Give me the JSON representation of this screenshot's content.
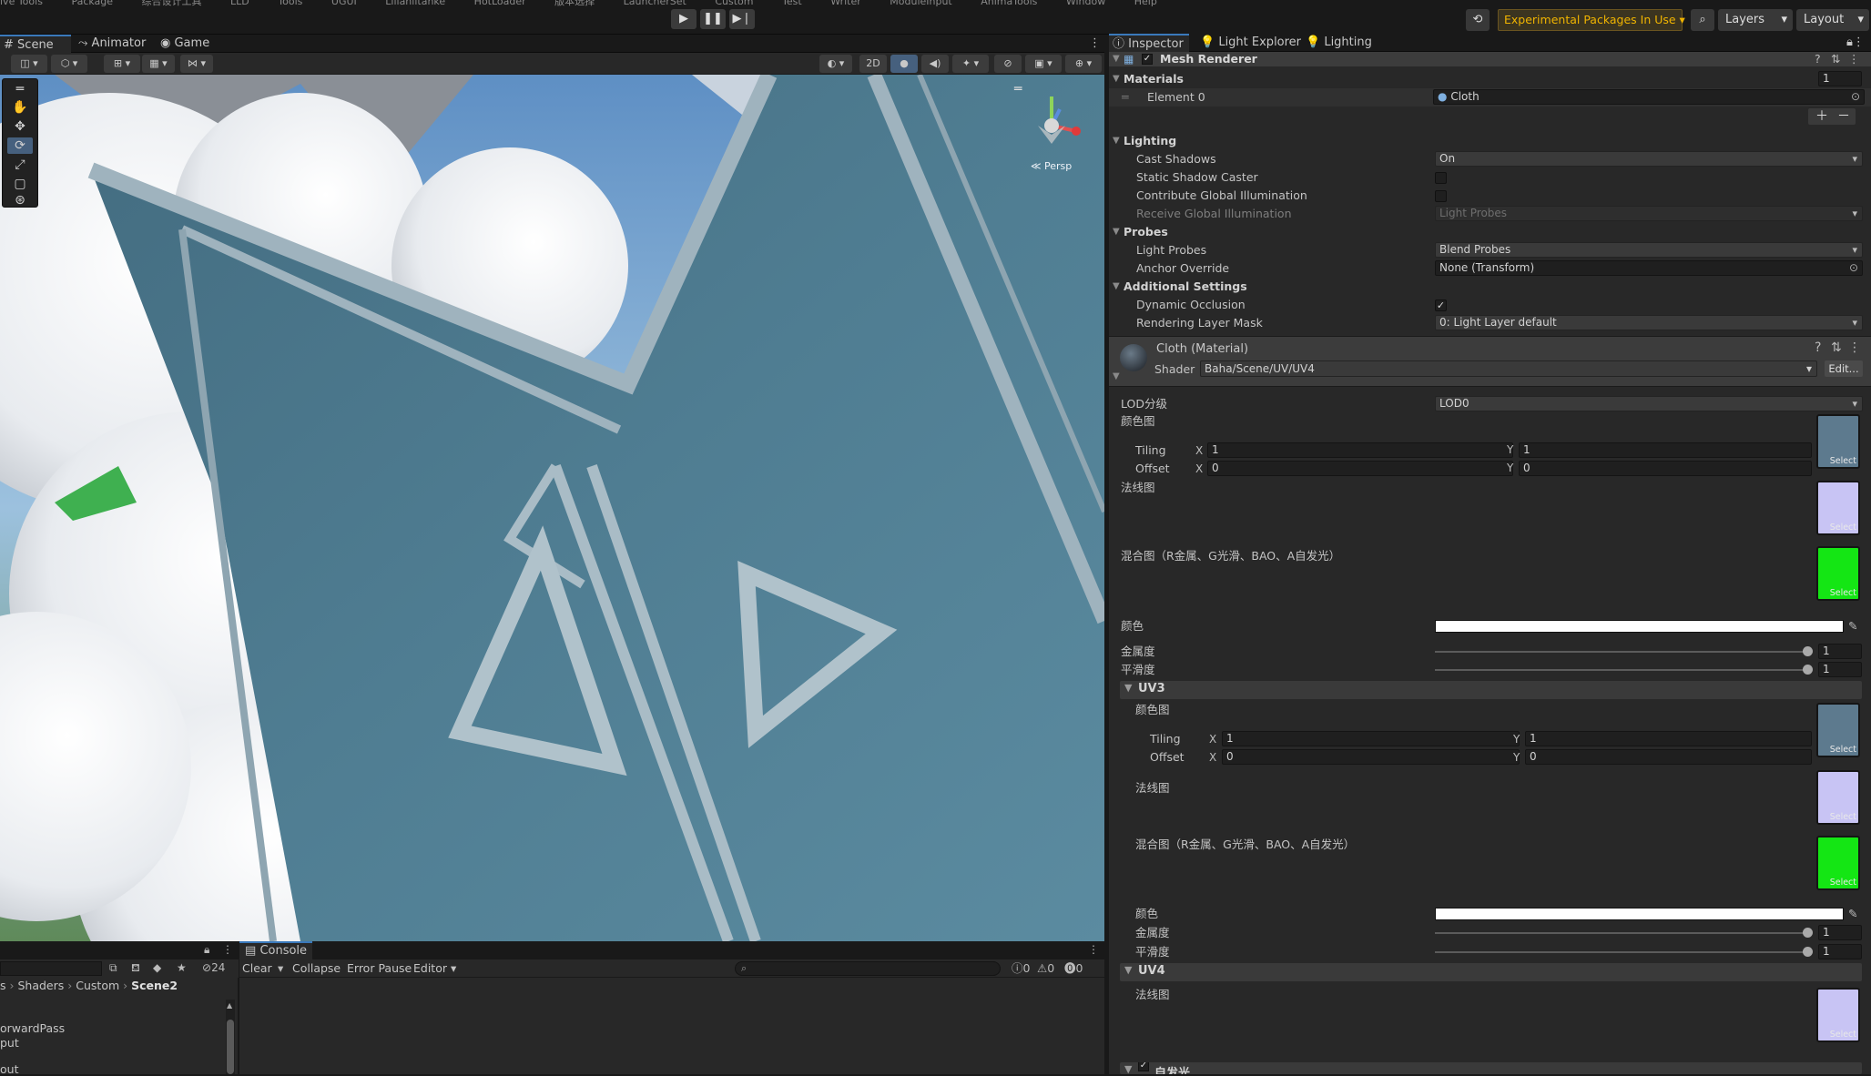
{
  "menu": [
    "ive Tools",
    "Package",
    "综合设计工具",
    "LLD",
    "Tools",
    "UGUI",
    "Lilianlitanke",
    "HotLoader",
    "版本选择",
    "LauncherSet",
    "Custom",
    "Test",
    "Writer",
    "ModuleInput",
    "AnimaTools",
    "Window",
    "Help"
  ],
  "toolbar": {
    "experimental_label": "Experimental Packages In Use ▾",
    "layers_label": "Layers",
    "layout_label": "Layout"
  },
  "scene_tabs": {
    "scene": "Scene",
    "animator": "Animator",
    "game": "Game"
  },
  "scene_toolbar": {
    "mode_2d": "2D"
  },
  "gizmo": {
    "persp_label": "≪ Persp"
  },
  "inspector_tabs": {
    "inspector": "Inspector",
    "light_explorer": "Light Explorer",
    "lighting": "Lighting"
  },
  "mesh_renderer": {
    "title": "Mesh Renderer",
    "materials_label": "Materials",
    "materials_count": "1",
    "element0_label": "Element 0",
    "element0_value": "Cloth",
    "lighting_label": "Lighting",
    "cast_shadows_label": "Cast Shadows",
    "cast_shadows_value": "On",
    "static_shadow_label": "Static Shadow Caster",
    "contribute_gi_label": "Contribute Global Illumination",
    "receive_gi_label": "Receive Global Illumination",
    "receive_gi_value": "Light Probes",
    "probes_label": "Probes",
    "light_probes_label": "Light Probes",
    "light_probes_value": "Blend Probes",
    "anchor_override_label": "Anchor Override",
    "anchor_override_value": "None (Transform)",
    "additional_label": "Additional Settings",
    "dynamic_occlusion_label": "Dynamic Occlusion",
    "rendering_layer_label": "Rendering Layer Mask",
    "rendering_layer_value": "0: Light Layer default"
  },
  "material": {
    "title": "Cloth (Material)",
    "shader_label": "Shader",
    "shader_value": "Baha/Scene/UV/UV4",
    "edit_label": "Edit...",
    "lod_label": "LOD分级",
    "lod_value": "LOD0",
    "color_map_label": "颜色图",
    "tiling_label": "Tiling",
    "offset_label": "Offset",
    "x_label": "X",
    "y_label": "Y",
    "tiling_x": "1",
    "tiling_y": "1",
    "offset_x": "0",
    "offset_y": "0",
    "normal_map_label": "法线图",
    "mix_map_label": "混合图（R金属、G光滑、BAO、A自发光）",
    "color_label": "颜色",
    "metal_label": "金属度",
    "metal_value": "1",
    "smooth_label": "平滑度",
    "smooth_value": "1",
    "select_label": "Select",
    "uv3_label": "UV3",
    "uv4_label": "UV4",
    "emission_label": "自发光",
    "colors": {
      "normal_swatch": "#c8c4f4",
      "mix_swatch": "#14e614",
      "color_swatch": "#ffffff"
    }
  },
  "hierarchy": {
    "breadcrumb": [
      "s",
      "Shaders",
      "Custom",
      "Scene2"
    ],
    "items": [
      "orwardPass",
      "put",
      "out"
    ],
    "visibility_count": "24"
  },
  "console": {
    "tab": "Console",
    "clear": "Clear",
    "collapse": "Collapse",
    "error_pause": "Error Pause",
    "editor": "Editor",
    "log_count": "0",
    "warn_count": "0",
    "error_count": "0"
  }
}
